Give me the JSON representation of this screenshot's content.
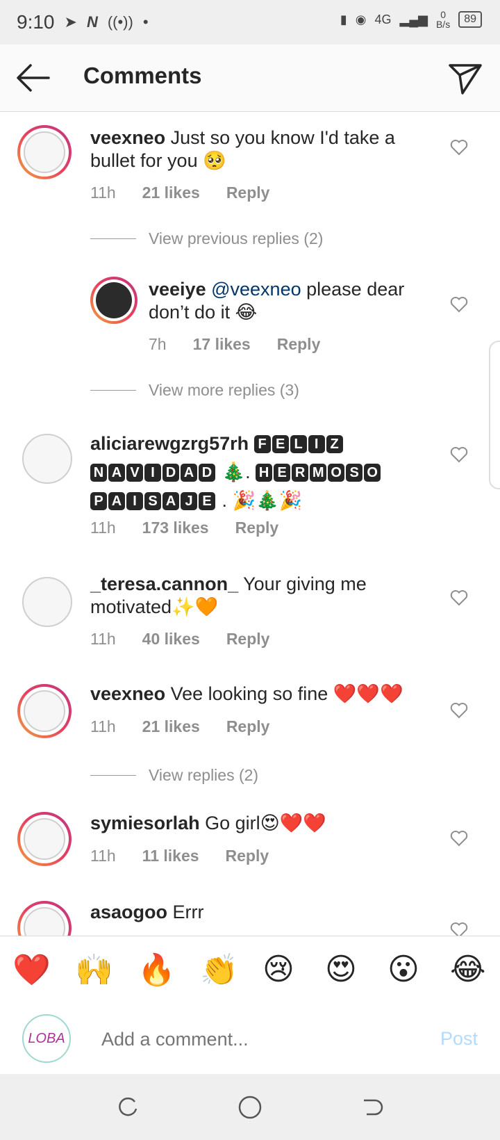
{
  "status_bar": {
    "time": "9:10",
    "net_speed": "0",
    "net_unit": "B/s",
    "network": "4G",
    "battery": "89"
  },
  "header": {
    "title": "Comments"
  },
  "comments": [
    {
      "user": "veexneo",
      "text": "Just so you know I'd take a bullet for you 🥺",
      "time": "11h",
      "likes": "21 likes",
      "reply": "Reply"
    },
    {
      "user": "veeiye",
      "mention": "@veexneo",
      "text": "please dear don’t do it 😂",
      "time": "7h",
      "likes": "17 likes",
      "reply": "Reply"
    },
    {
      "user": "aliciarewgzrg57rh",
      "time": "11h",
      "likes": "173 likes",
      "reply": "Reply"
    },
    {
      "user": "_teresa.cannon_",
      "text": "Your giving me motivated✨🧡",
      "time": "11h",
      "likes": "40 likes",
      "reply": "Reply"
    },
    {
      "user": "veexneo",
      "text": "Vee looking so fine ❤️❤️❤️",
      "time": "11h",
      "likes": "21 likes",
      "reply": "Reply"
    },
    {
      "user": "symiesorlah",
      "text": "Go girl😍❤️❤️",
      "time": "11h",
      "likes": "11 likes",
      "reply": "Reply"
    },
    {
      "user": "asaogoo",
      "text": "Errr"
    }
  ],
  "special_text": {
    "line1_word": [
      "F",
      "E",
      "L",
      "I",
      "Z"
    ],
    "line2_word": [
      "N",
      "A",
      "V",
      "I",
      "D",
      "A",
      "D"
    ],
    "line2_suffix": "🎄.",
    "line2_word2": [
      "H",
      "E",
      "R",
      "M",
      "O",
      "S",
      "O"
    ],
    "line3_word": [
      "P",
      "A",
      "I",
      "S",
      "A",
      "J",
      "E"
    ],
    "line3_suffix": ". 🎉🎄🎉"
  },
  "view_links": {
    "previous": "View previous replies (2)",
    "more": "View more replies (3)",
    "replies": "View replies (2)"
  },
  "reactions": [
    "❤️",
    "🙌",
    "🔥",
    "👏",
    "😢",
    "😍",
    "😮",
    "😂"
  ],
  "composer": {
    "avatar_text": "LOBA",
    "placeholder": "Add a comment...",
    "post": "Post"
  }
}
